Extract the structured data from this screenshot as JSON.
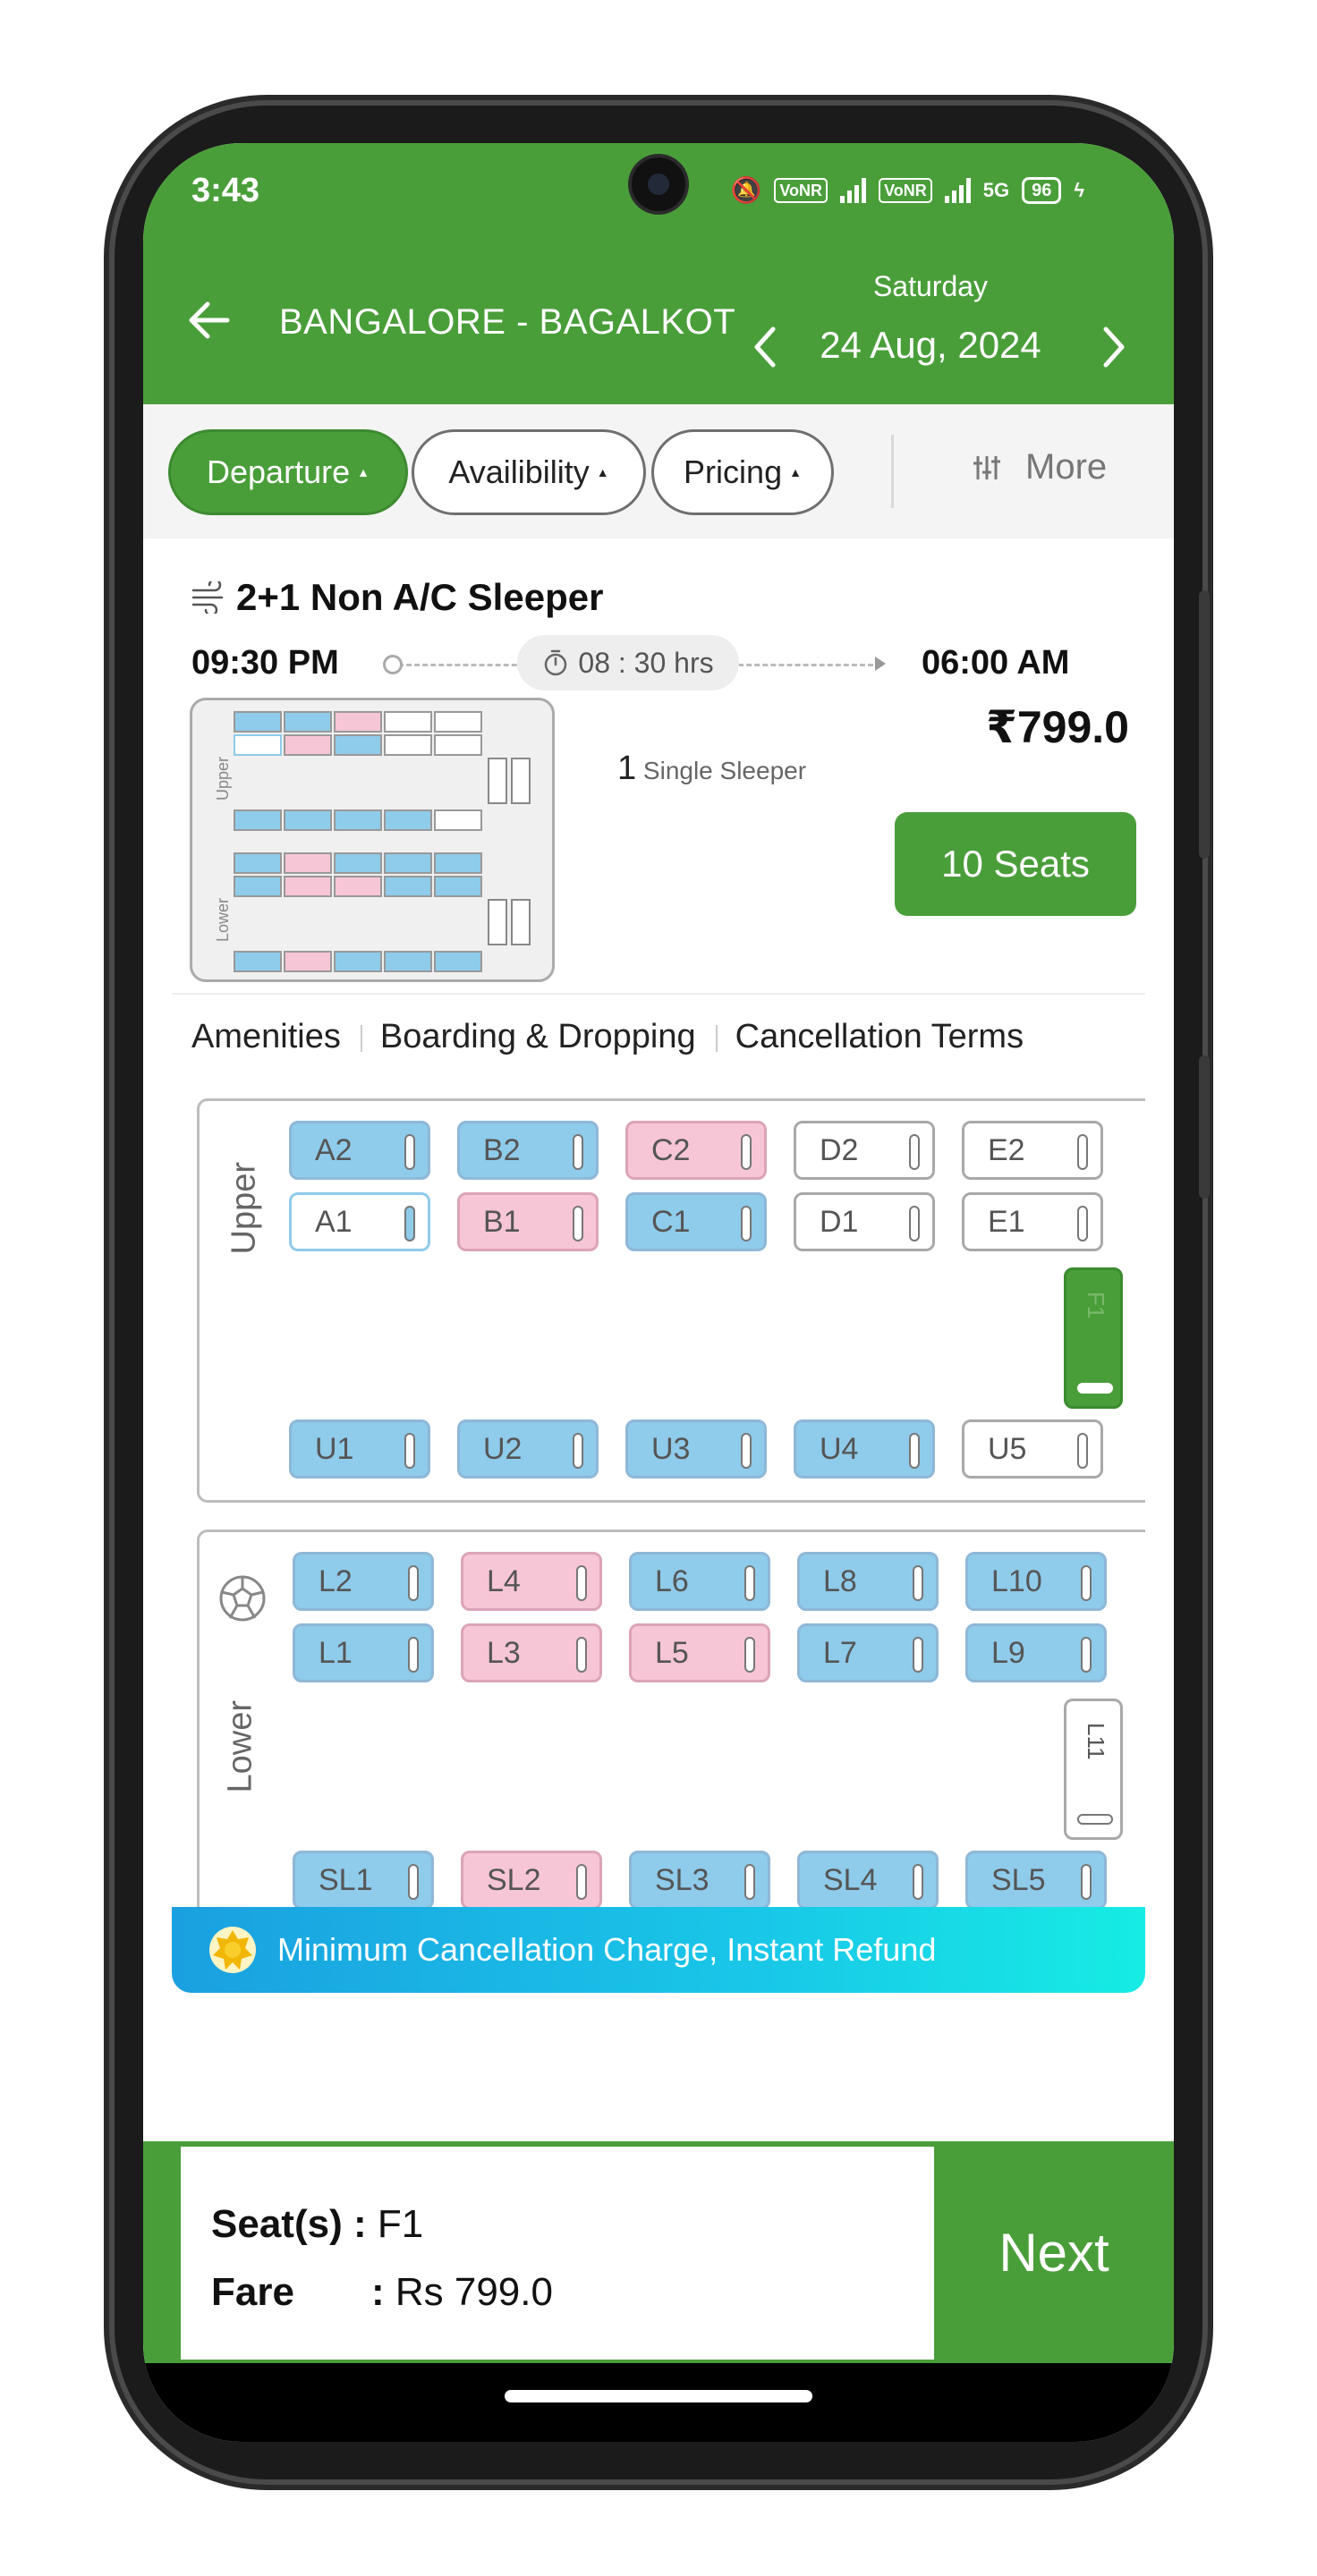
{
  "status": {
    "time": "3:43",
    "network1": "VoNR",
    "network2": "VoNR",
    "gen": "5G",
    "battery": "96"
  },
  "header": {
    "route": "BANGALORE - BAGALKOT",
    "day": "Saturday",
    "date": "24 Aug, 2024"
  },
  "filters": {
    "chips": [
      "Departure",
      "Availibility",
      "Pricing"
    ],
    "more_label": "More"
  },
  "bus": {
    "type": "2+1 Non A/C Sleeper",
    "departure": "09:30 PM",
    "arrival": "06:00 AM",
    "duration": "08 : 30 hrs",
    "price": "₹799.0",
    "sleeper_count": "1",
    "sleeper_label": "Single Sleeper",
    "seats_button": "10 Seats",
    "mini_upper_label": "Upper",
    "mini_lower_label": "Lower"
  },
  "tabs": [
    "Amenities",
    "Boarding & Dropping",
    "Cancellation Terms"
  ],
  "upper_deck": {
    "label": "Upper",
    "row1": [
      {
        "id": "A2",
        "state": "blue"
      },
      {
        "id": "B2",
        "state": "blue"
      },
      {
        "id": "C2",
        "state": "pink"
      },
      {
        "id": "D2",
        "state": "white"
      },
      {
        "id": "E2",
        "state": "white"
      }
    ],
    "row2": [
      {
        "id": "A1",
        "state": "selected"
      },
      {
        "id": "B1",
        "state": "pink"
      },
      {
        "id": "C1",
        "state": "blue"
      },
      {
        "id": "D1",
        "state": "white"
      },
      {
        "id": "E1",
        "state": "white"
      }
    ],
    "single": {
      "id": "F1",
      "state": "green"
    },
    "row3": [
      {
        "id": "U1",
        "state": "blue"
      },
      {
        "id": "U2",
        "state": "blue"
      },
      {
        "id": "U3",
        "state": "blue"
      },
      {
        "id": "U4",
        "state": "blue"
      },
      {
        "id": "U5",
        "state": "white"
      }
    ]
  },
  "lower_deck": {
    "label": "Lower",
    "row1": [
      {
        "id": "L2",
        "state": "blue"
      },
      {
        "id": "L4",
        "state": "pink"
      },
      {
        "id": "L6",
        "state": "blue"
      },
      {
        "id": "L8",
        "state": "blue"
      },
      {
        "id": "L10",
        "state": "blue"
      }
    ],
    "row2": [
      {
        "id": "L1",
        "state": "blue"
      },
      {
        "id": "L3",
        "state": "pink"
      },
      {
        "id": "L5",
        "state": "pink"
      },
      {
        "id": "L7",
        "state": "blue"
      },
      {
        "id": "L9",
        "state": "blue"
      }
    ],
    "single": {
      "id": "L11",
      "state": "white"
    },
    "row3": [
      {
        "id": "SL1",
        "state": "blue"
      },
      {
        "id": "SL2",
        "state": "pink"
      },
      {
        "id": "SL3",
        "state": "blue"
      },
      {
        "id": "SL4",
        "state": "blue"
      },
      {
        "id": "SL5",
        "state": "blue"
      }
    ]
  },
  "banner": {
    "text": "Minimum Cancellation Charge, Instant Refund"
  },
  "summary": {
    "seat_label": "Seat(s)",
    "seat_value": "F1",
    "fare_label": "Fare",
    "fare_value": "Rs 799.0",
    "next_label": "Next"
  },
  "colors": {
    "brand_green": "#4a9e3a",
    "seat_blue": "#8fcbea",
    "seat_pink": "#f7c6d6"
  }
}
